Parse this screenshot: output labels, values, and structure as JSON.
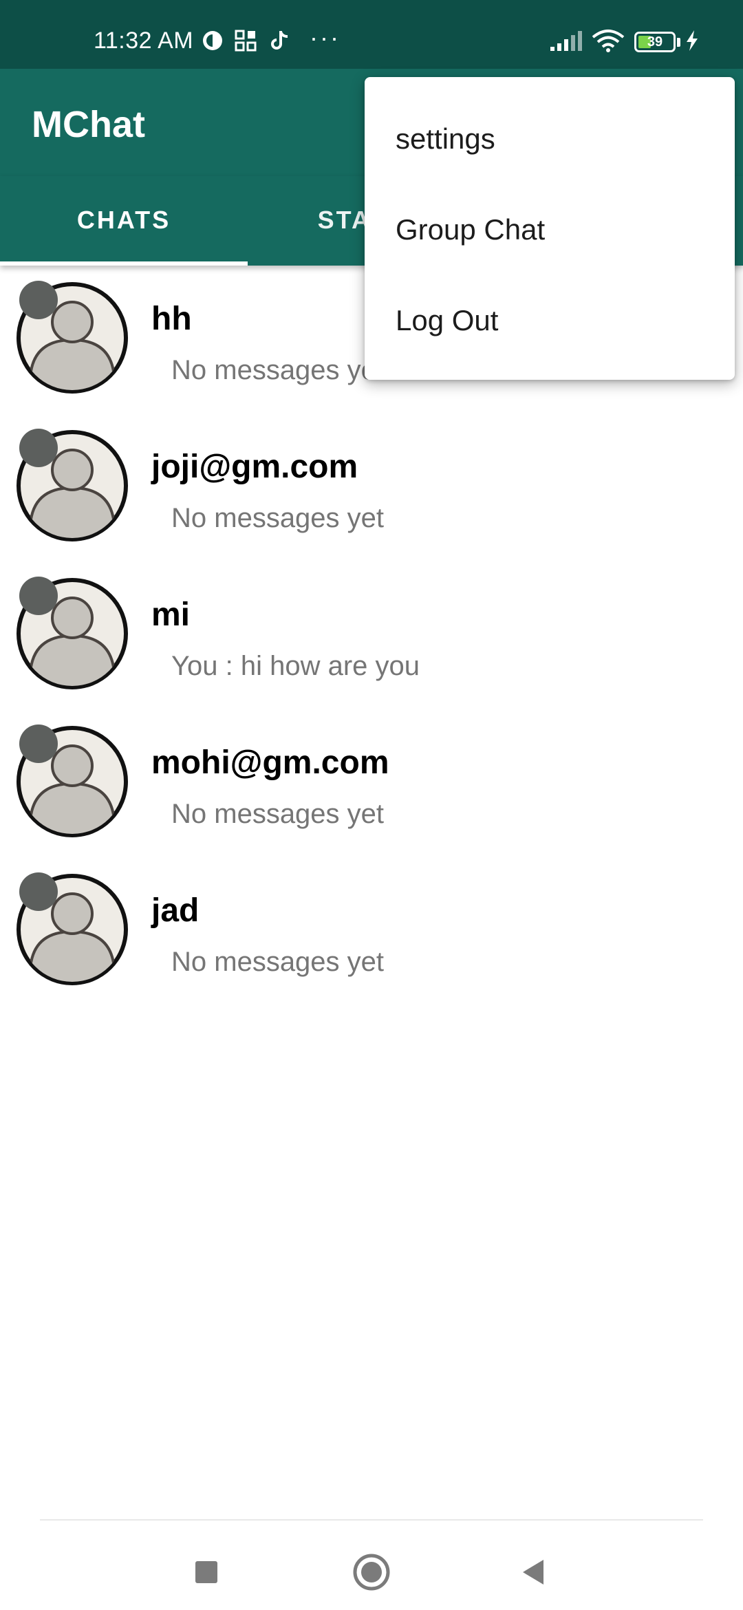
{
  "status_bar": {
    "time": "11:32 AM",
    "battery": "39",
    "icons": [
      "data-saver-icon",
      "app-grid-icon",
      "tiktok-icon",
      "more-dots-icon",
      "signal-icon",
      "wifi-icon",
      "battery-icon",
      "charging-icon"
    ],
    "more": "···"
  },
  "app_bar": {
    "title": "MChat",
    "color": "#156a5f"
  },
  "tabs": [
    {
      "label": "CHATS",
      "selected": true
    },
    {
      "label": "STATUS",
      "selected": false
    }
  ],
  "chats": [
    {
      "name": "hh",
      "preview": "No messages yet"
    },
    {
      "name": "joji@gm.com",
      "preview": "No messages yet"
    },
    {
      "name": "mi",
      "preview": "You :  hi how are you"
    },
    {
      "name": "mohi@gm.com",
      "preview": "No messages yet"
    },
    {
      "name": "jad",
      "preview": "No messages yet"
    }
  ],
  "menu": {
    "items": [
      "settings",
      "Group Chat",
      "Log Out"
    ]
  },
  "nav": {
    "icons": [
      "recents-square-icon",
      "home-circle-icon",
      "back-triangle-icon"
    ]
  },
  "colors": {
    "status_bar": "#0d4f47",
    "accent": "#156a5f",
    "presence_dot": "#5c5f5d",
    "preview_text": "#757575"
  }
}
